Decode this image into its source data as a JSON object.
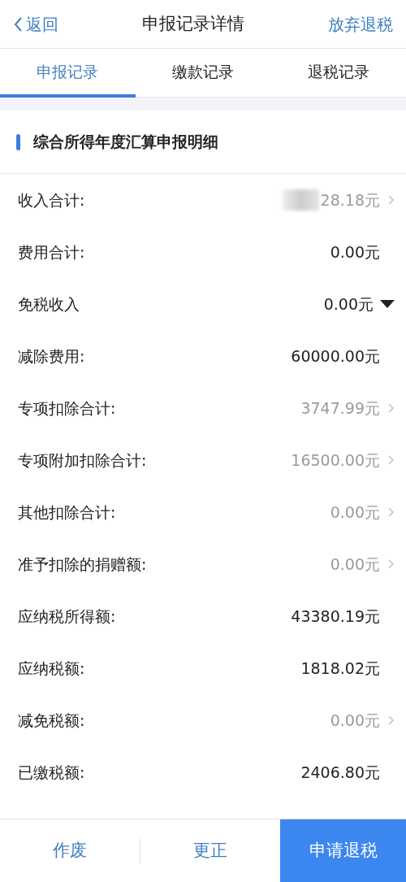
{
  "header": {
    "back": "返回",
    "title": "申报记录详情",
    "action": "放弃退税"
  },
  "tabs": [
    {
      "label": "申报记录",
      "selected": true
    },
    {
      "label": "缴款记录",
      "selected": false
    },
    {
      "label": "退税记录",
      "selected": false
    }
  ],
  "section": {
    "title": "综合所得年度汇算申报明细"
  },
  "rows": [
    {
      "label": "收入合计:",
      "value": "28.18元",
      "kind": "link",
      "redacted": true
    },
    {
      "label": "费用合计:",
      "value": "0.00元",
      "kind": "plain"
    },
    {
      "label": "免税收入",
      "value": "0.00元",
      "kind": "dropdown"
    },
    {
      "label": "减除费用:",
      "value": "60000.00元",
      "kind": "plain"
    },
    {
      "label": "专项扣除合计:",
      "value": "3747.99元",
      "kind": "link"
    },
    {
      "label": "专项附加扣除合计:",
      "value": "16500.00元",
      "kind": "link"
    },
    {
      "label": "其他扣除合计:",
      "value": "0.00元",
      "kind": "link"
    },
    {
      "label": "准予扣除的捐赠额:",
      "value": "0.00元",
      "kind": "link"
    },
    {
      "label": "应纳税所得额:",
      "value": "43380.19元",
      "kind": "plain"
    },
    {
      "label": "应纳税额:",
      "value": "1818.02元",
      "kind": "plain"
    },
    {
      "label": "减免税额:",
      "value": "0.00元",
      "kind": "link"
    },
    {
      "label": "已缴税额:",
      "value": "2406.80元",
      "kind": "plain"
    }
  ],
  "footer": [
    {
      "label": "作废",
      "primary": false
    },
    {
      "label": "更正",
      "primary": false
    },
    {
      "label": "申请退税",
      "primary": true
    }
  ]
}
